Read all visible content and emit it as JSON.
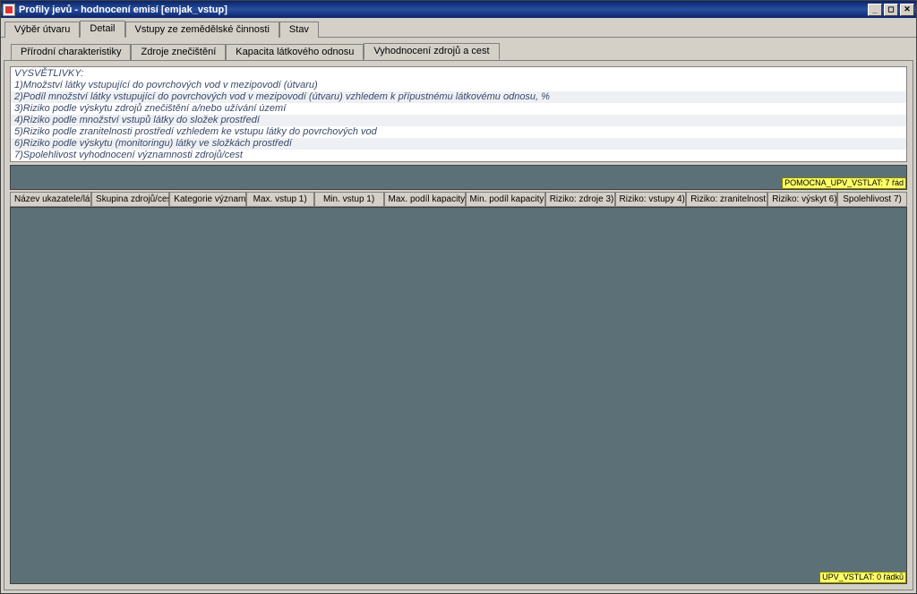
{
  "window": {
    "title": "Profily jevů - hodnocení emisí [emjak_vstup]"
  },
  "primary_tabs": [
    {
      "label": "Výběr útvaru",
      "active": false
    },
    {
      "label": "Detail",
      "active": true
    },
    {
      "label": "Vstupy ze zemědělské činnosti",
      "active": false
    },
    {
      "label": "Stav",
      "active": false
    }
  ],
  "secondary_tabs": [
    {
      "label": "Přírodní charakteristiky",
      "active": false
    },
    {
      "label": "Zdroje znečištění",
      "active": false
    },
    {
      "label": "Kapacita látkového odnosu",
      "active": false
    },
    {
      "label": "Vyhodnocení zdrojů a cest",
      "active": true
    }
  ],
  "legend": {
    "header": "VYSVĚTLIVKY:",
    "rows": [
      "1)Množství látky vstupující do povrchových vod v mezipovodí (útvaru)",
      "2)Podíl množství látky vstupující do povrchových vod v mezipovodí (útvaru) vzhledem k přípustnému látkovému odnosu, %",
      "3)Riziko podle výskytu zdrojů znečištění a/nebo užívání území",
      "4)Riziko podle množství vstupů látky do složek prostředí",
      "5)Riziko podle zranitelnosti prostředí vzhledem ke vstupu látky do povrchových vod",
      "6)Riziko podle výskytu (monitoringu) látky ve složkách prostředí",
      "7)Spolehlivost vyhodnocení významnosti zdrojů/cest"
    ]
  },
  "grid_headers": [
    "Název ukazatele/lát",
    "Skupina zdrojů/ces",
    "Kategorie významn",
    "Max. vstup 1)",
    "Min. vstup 1)",
    "Max. podíl kapacity",
    "Min. podíl kapacity",
    "Riziko: zdroje 3)",
    "Riziko: vstupy 4)",
    "Riziko: zranitelnost",
    "Riziko: výskyt 6)",
    "Spolehlivost 7)"
  ],
  "grid_widths": [
    96,
    92,
    90,
    80,
    82,
    96,
    94,
    82,
    84,
    96,
    82,
    82
  ],
  "status": {
    "top_right": "POMOCNA_UPV_VSTLAT: 7 řád",
    "bottom_right": "UPV_VSTLAT: 0 řádků"
  }
}
